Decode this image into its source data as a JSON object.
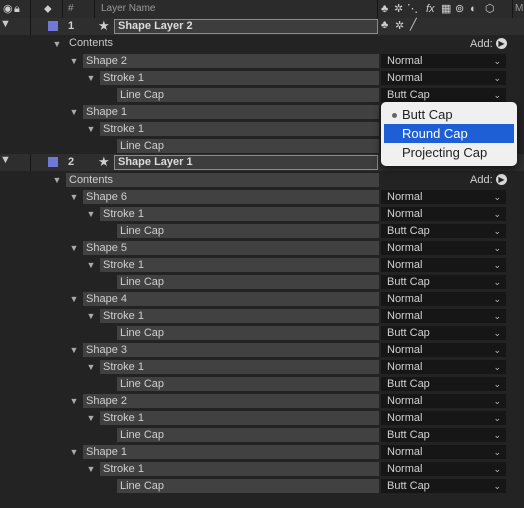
{
  "header": {
    "col_hash": "#",
    "col_layer_name": "Layer Name",
    "col_m": "M"
  },
  "layers": [
    {
      "number": "1",
      "name": "Shape Layer 2",
      "color": "#6f78d4"
    },
    {
      "number": "2",
      "name": "Shape Layer 1",
      "color": "#6f78d4"
    }
  ],
  "contents_label": "Contents",
  "add_label": "Add:",
  "rows_layer1": [
    {
      "type": "shape",
      "label": "Shape 2",
      "value": "Normal"
    },
    {
      "type": "stroke",
      "label": "Stroke 1",
      "value": "Normal"
    },
    {
      "type": "cap",
      "label": "Line Cap",
      "value": "Butt Cap"
    },
    {
      "type": "shape",
      "label": "Shape 1",
      "value": ""
    },
    {
      "type": "stroke",
      "label": "Stroke 1",
      "value": ""
    },
    {
      "type": "cap",
      "label": "Line Cap",
      "value": ""
    }
  ],
  "rows_layer2": [
    {
      "type": "shape",
      "label": "Shape 6",
      "value": "Normal"
    },
    {
      "type": "stroke",
      "label": "Stroke 1",
      "value": "Normal"
    },
    {
      "type": "cap",
      "label": "Line Cap",
      "value": "Butt Cap"
    },
    {
      "type": "shape",
      "label": "Shape 5",
      "value": "Normal"
    },
    {
      "type": "stroke",
      "label": "Stroke 1",
      "value": "Normal"
    },
    {
      "type": "cap",
      "label": "Line Cap",
      "value": "Butt Cap"
    },
    {
      "type": "shape",
      "label": "Shape 4",
      "value": "Normal"
    },
    {
      "type": "stroke",
      "label": "Stroke 1",
      "value": "Normal"
    },
    {
      "type": "cap",
      "label": "Line Cap",
      "value": "Butt Cap"
    },
    {
      "type": "shape",
      "label": "Shape 3",
      "value": "Normal"
    },
    {
      "type": "stroke",
      "label": "Stroke 1",
      "value": "Normal"
    },
    {
      "type": "cap",
      "label": "Line Cap",
      "value": "Butt Cap"
    },
    {
      "type": "shape",
      "label": "Shape 2",
      "value": "Normal"
    },
    {
      "type": "stroke",
      "label": "Stroke 1",
      "value": "Normal"
    },
    {
      "type": "cap",
      "label": "Line Cap",
      "value": "Butt Cap"
    },
    {
      "type": "shape",
      "label": "Shape 1",
      "value": "Normal"
    },
    {
      "type": "stroke",
      "label": "Stroke 1",
      "value": "Normal"
    },
    {
      "type": "cap",
      "label": "Line Cap",
      "value": "Butt Cap"
    }
  ],
  "popup": {
    "options": [
      "Butt Cap",
      "Round Cap",
      "Projecting Cap"
    ],
    "checked": "Butt Cap",
    "highlighted": "Round Cap",
    "highlight_color": "#1f5fd6"
  },
  "icons": {
    "eye": "eye-icon",
    "lock": "lock-icon",
    "label": "tag-icon",
    "star": "shape-star-icon",
    "caret": "twirl-down-icon",
    "chevron": "chevron-down-icon",
    "add": "play-circle-icon"
  }
}
